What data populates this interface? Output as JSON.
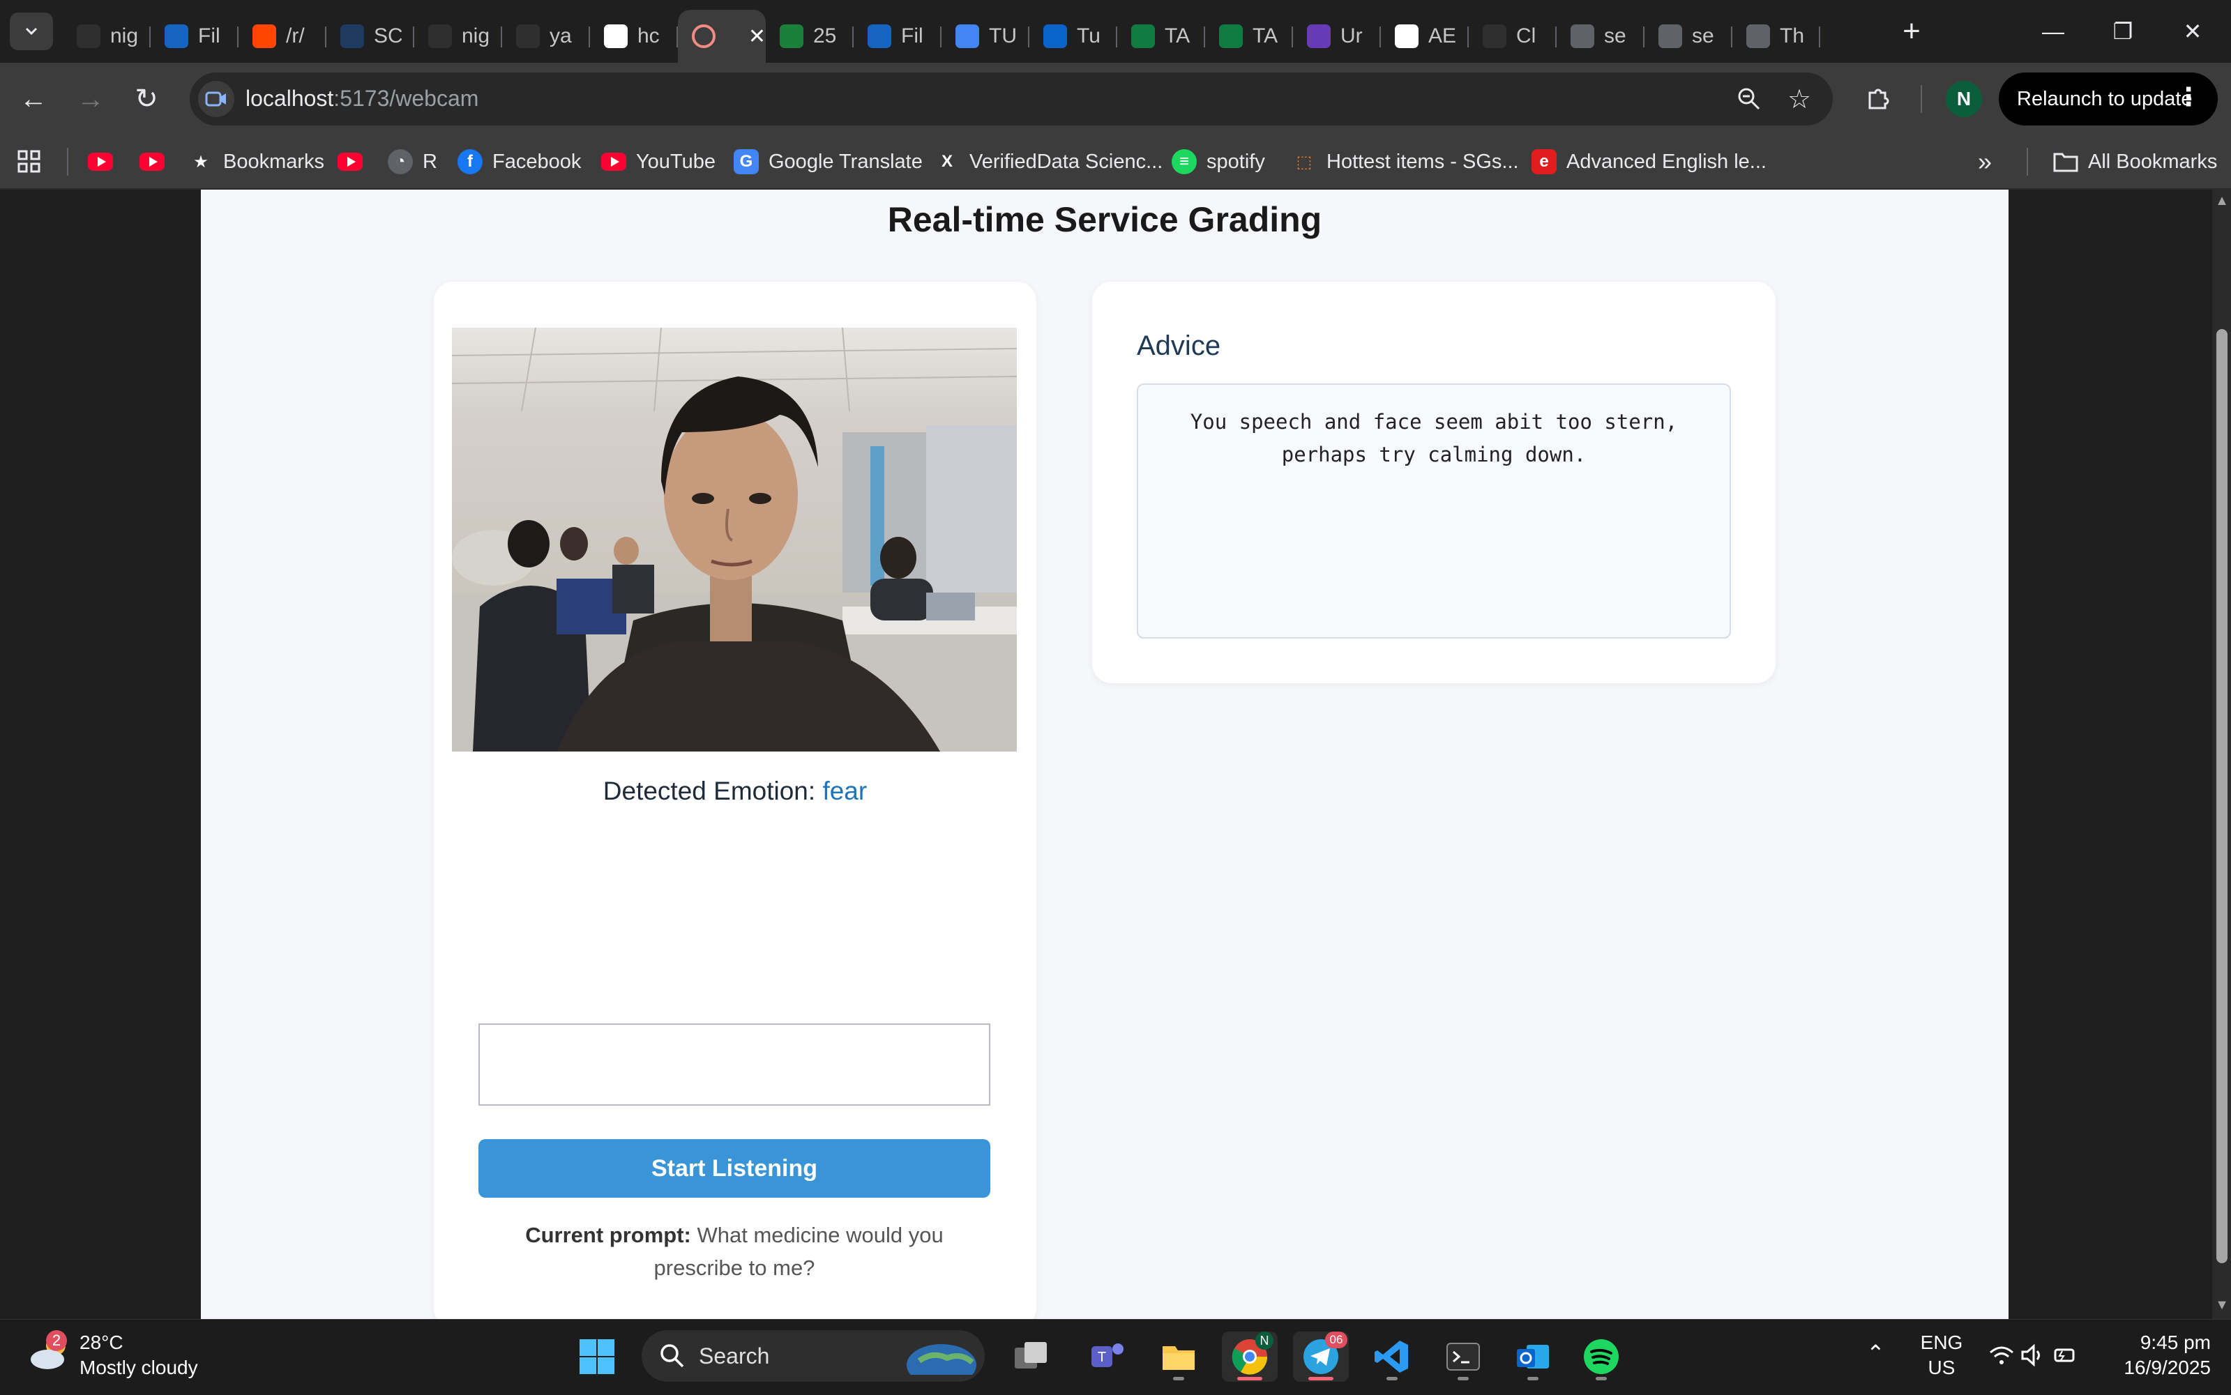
{
  "browser": {
    "tabs": [
      {
        "title": "nig",
        "icon": "chatgpt-icon",
        "color": "#2f2f2f"
      },
      {
        "title": "Fil",
        "icon": "file-icon",
        "color": "#1565c0"
      },
      {
        "title": "/r/",
        "icon": "reddit-icon",
        "color": "#ff4500"
      },
      {
        "title": "SC",
        "icon": "cloud-icon",
        "color": "#1e3a5f"
      },
      {
        "title": "nig",
        "icon": "github-icon",
        "color": "#2f2f2f"
      },
      {
        "title": "ya",
        "icon": "github-icon",
        "color": "#2f2f2f"
      },
      {
        "title": "hc",
        "icon": "google-icon",
        "color": "#ffffff"
      },
      {
        "title": "",
        "icon": "record-icon",
        "color": "#f28b82",
        "active": true
      },
      {
        "title": "25",
        "icon": "drive-icon",
        "color": "#188038"
      },
      {
        "title": "Fil",
        "icon": "file-icon",
        "color": "#1565c0"
      },
      {
        "title": "TU",
        "icon": "docs-icon",
        "color": "#4285f4"
      },
      {
        "title": "Tu",
        "icon": "onedrive-icon",
        "color": "#0a63c9"
      },
      {
        "title": "TA",
        "icon": "excel-icon",
        "color": "#107c41"
      },
      {
        "title": "TA",
        "icon": "excel-icon",
        "color": "#107c41"
      },
      {
        "title": "Ur",
        "icon": "forms-icon",
        "color": "#673ab7"
      },
      {
        "title": "AE",
        "icon": "building-icon",
        "color": "#ffffff"
      },
      {
        "title": "Cl",
        "icon": "chatgpt-icon",
        "color": "#2f2f2f"
      },
      {
        "title": "se",
        "icon": "globe-icon",
        "color": "#5f6368"
      },
      {
        "title": "se",
        "icon": "globe-icon",
        "color": "#5f6368"
      },
      {
        "title": "Th",
        "icon": "globe-icon",
        "color": "#5f6368"
      }
    ],
    "url_host": "localhost",
    "url_path": ":5173/webcam",
    "profile_initial": "N",
    "relaunch_label": "Relaunch to update",
    "bookmarks": [
      {
        "label": "",
        "icon": "youtube-icon"
      },
      {
        "label": "",
        "icon": "youtube-icon"
      },
      {
        "label": "Bookmarks",
        "icon": "star-icon"
      },
      {
        "label": "",
        "icon": "youtube-icon"
      },
      {
        "label": "R",
        "icon": "globe-icon"
      },
      {
        "label": "Facebook",
        "icon": "facebook-icon"
      },
      {
        "label": "YouTube",
        "icon": "youtube-icon"
      },
      {
        "label": "Google Translate",
        "icon": "translate-icon"
      },
      {
        "label": "VerifiedData Scienc...",
        "icon": "x-icon"
      },
      {
        "label": "spotify",
        "icon": "spotify-icon"
      },
      {
        "label": "Hottest items - SGs...",
        "icon": "shop-icon"
      },
      {
        "label": "Advanced English le...",
        "icon": "e-icon"
      }
    ],
    "all_bookmarks_label": "All Bookmarks"
  },
  "page": {
    "title": "Real-time Service Grading",
    "emotion_label": "Detected Emotion:",
    "emotion_value": "fear",
    "input_value": "",
    "start_button": "Start Listening",
    "prompt_label": "Current prompt:",
    "prompt_text": "What medicine would you prescribe to me?",
    "advice_heading": "Advice",
    "advice_text": "You speech and face seem abit too stern, perhaps try calming down."
  },
  "taskbar": {
    "weather_badge": "2",
    "temperature": "28°C",
    "condition": "Mostly cloudy",
    "search_label": "Search",
    "telegram_badge": "06",
    "language_top": "ENG",
    "language_bottom": "US",
    "time": "9:45 pm",
    "date": "16/9/2025"
  }
}
